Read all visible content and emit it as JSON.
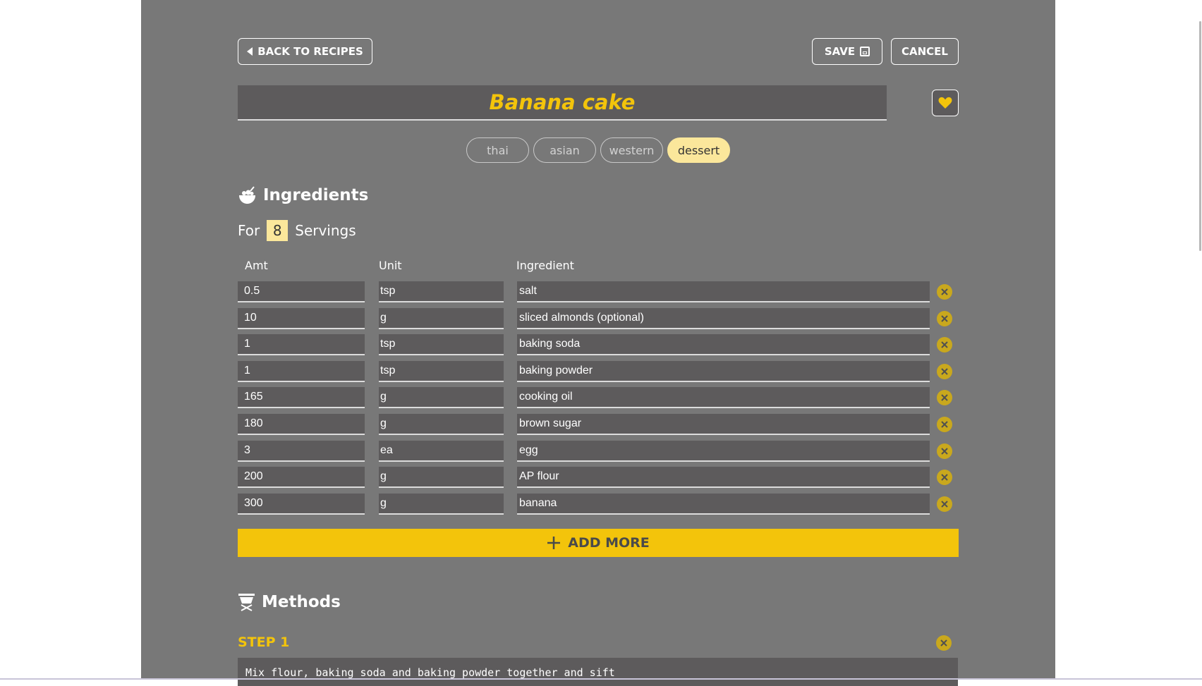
{
  "header": {
    "back_label": "BACK TO RECIPES",
    "save_label": "SAVE",
    "cancel_label": "CANCEL"
  },
  "recipe": {
    "title": "Banana cake",
    "favorite_icon": "heart-icon",
    "tags": [
      {
        "label": "thai",
        "selected": false
      },
      {
        "label": "asian",
        "selected": false
      },
      {
        "label": "western",
        "selected": false
      },
      {
        "label": "dessert",
        "selected": true
      }
    ]
  },
  "ingredients": {
    "heading": "Ingredients",
    "icon": "bowl-icon",
    "servings_prefix": "For",
    "servings_value": "8",
    "servings_suffix": "Servings",
    "columns": {
      "amt": "Amt",
      "unit": "Unit",
      "ingredient": "Ingredient"
    },
    "rows": [
      {
        "amt": "0.5",
        "unit": "tsp",
        "ingredient": "salt"
      },
      {
        "amt": "10",
        "unit": "g",
        "ingredient": "sliced almonds (optional)"
      },
      {
        "amt": "1",
        "unit": "tsp",
        "ingredient": "baking soda"
      },
      {
        "amt": "1",
        "unit": "tsp",
        "ingredient": "baking powder"
      },
      {
        "amt": "165",
        "unit": "g",
        "ingredient": "cooking oil"
      },
      {
        "amt": "180",
        "unit": "g",
        "ingredient": "brown sugar"
      },
      {
        "amt": "3",
        "unit": "ea",
        "ingredient": "egg"
      },
      {
        "amt": "200",
        "unit": "g",
        "ingredient": "AP flour"
      },
      {
        "amt": "300",
        "unit": "g",
        "ingredient": "banana"
      }
    ],
    "add_more_label": "ADD MORE"
  },
  "methods": {
    "heading": "Methods",
    "icon": "cooking-pot-icon",
    "steps": [
      {
        "label": "STEP 1",
        "text": "Mix flour, baking soda and baking powder together and sift"
      }
    ]
  },
  "colors": {
    "accent": "#f3c40b",
    "panel": "#787878",
    "field": "#5d5b5c",
    "tag_active": "#fbe79b",
    "remove_icon": "#c9a81d"
  }
}
